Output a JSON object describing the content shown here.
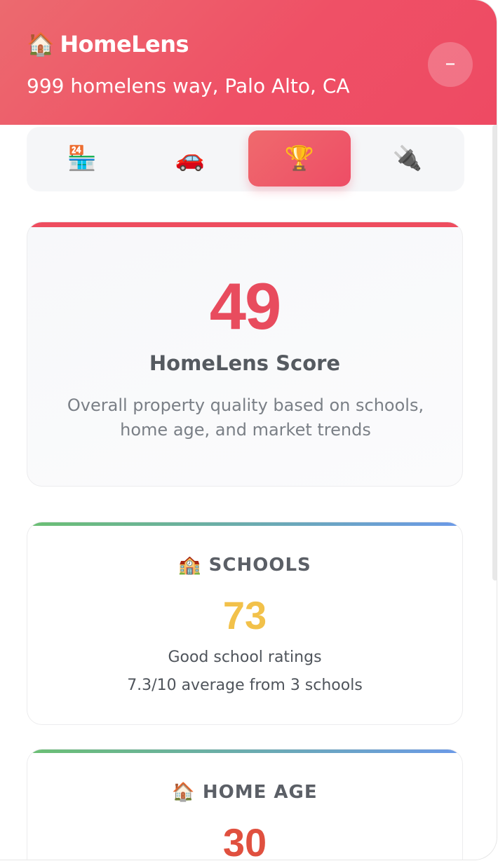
{
  "header": {
    "brand_icon": "🏠",
    "brand_name": "HomeLens",
    "address": "999 homelens way, Palo Alto, CA",
    "collapse_label": "–"
  },
  "tabs": [
    {
      "icon": "🏪",
      "name": "convenience-store-icon",
      "active": false
    },
    {
      "icon": "🚗",
      "name": "car-icon",
      "active": false
    },
    {
      "icon": "🏆",
      "name": "trophy-icon",
      "active": true
    },
    {
      "icon": "🔌",
      "name": "electric-plug-icon",
      "active": false
    }
  ],
  "score_card": {
    "value": "49",
    "label": "HomeLens Score",
    "description": "Overall property quality based on schools, home age, and market trends",
    "accent_color": "#e84c5e"
  },
  "schools": {
    "icon": "🏫",
    "title": "SCHOOLS",
    "value": "73",
    "value_color": "#f2c14a",
    "line1": "Good school ratings",
    "line2": "7.3/10 average from 3 schools"
  },
  "home_age": {
    "icon": "🏠",
    "title": "HOME AGE",
    "value": "30",
    "value_color": "#e0503f"
  }
}
